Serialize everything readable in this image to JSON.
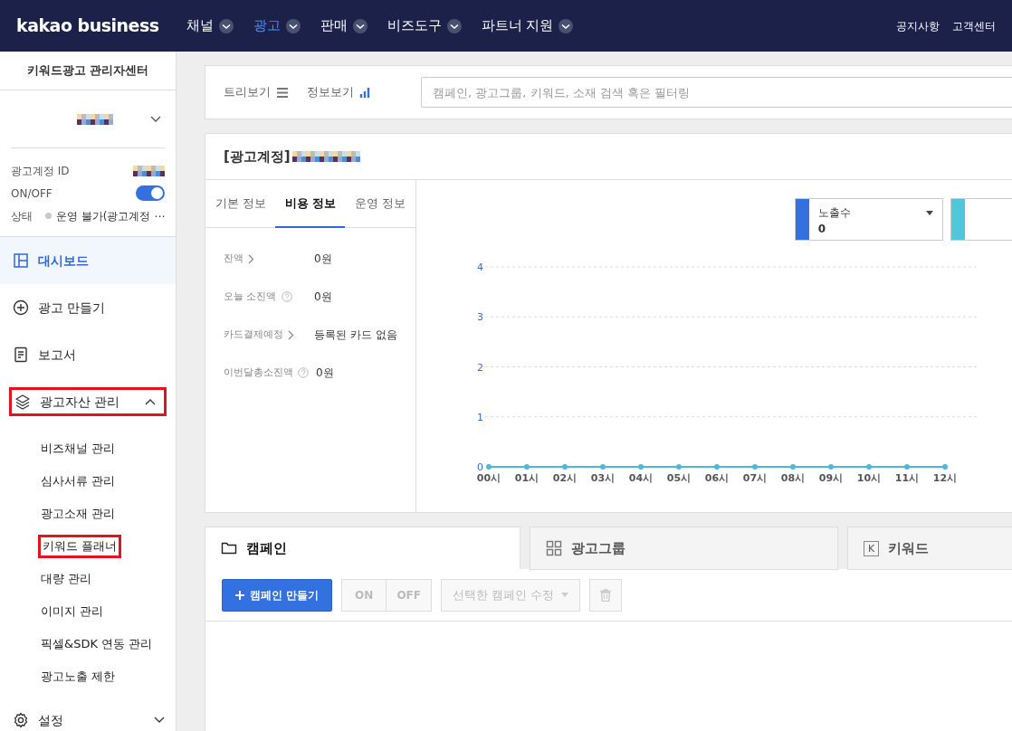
{
  "topnav": {
    "logo": "kakao business",
    "items": [
      {
        "label": "채널",
        "selected": false
      },
      {
        "label": "광고",
        "selected": true
      },
      {
        "label": "판매",
        "selected": false
      },
      {
        "label": "비즈도구",
        "selected": false
      },
      {
        "label": "파트너 지원",
        "selected": false
      }
    ],
    "links": [
      "공지사항",
      "고객센터"
    ]
  },
  "sidebar": {
    "title": "키워드광고 관리자센터",
    "info": [
      {
        "kind": "id",
        "label": "광고계정 ID"
      },
      {
        "kind": "toggle",
        "label": "ON/OFF",
        "on": true
      },
      {
        "kind": "status",
        "label": "상태",
        "value": "운영 불가(광고계정 ⋯"
      }
    ],
    "menu": [
      {
        "kind": "dashboard",
        "label": "대시보드",
        "selected": true,
        "highlighted": false
      },
      {
        "kind": "create",
        "label": "광고 만들기",
        "selected": false,
        "highlighted": false
      },
      {
        "kind": "report",
        "label": "보고서",
        "selected": false,
        "highlighted": false
      },
      {
        "kind": "assets",
        "label": "광고자산 관리",
        "selected": false,
        "highlighted": true,
        "expanded": true,
        "children": [
          {
            "label": "비즈채널 관리",
            "highlighted": false
          },
          {
            "label": "심사서류 관리",
            "highlighted": false
          },
          {
            "label": "광고소재 관리",
            "highlighted": false
          },
          {
            "label": "키워드 플래너",
            "highlighted": true
          },
          {
            "label": "대량 관리",
            "highlighted": false
          },
          {
            "label": "이미지 관리",
            "highlighted": false
          },
          {
            "label": "픽셀&SDK 연동 관리",
            "highlighted": false
          },
          {
            "label": "광고노출 제한",
            "highlighted": false
          }
        ]
      },
      {
        "kind": "settings",
        "label": "설정",
        "selected": false,
        "highlighted": false,
        "expanded": false
      }
    ]
  },
  "viewbar": {
    "views": [
      {
        "kind": "tree",
        "label": "트리보기"
      },
      {
        "kind": "info",
        "label": "정보보기"
      }
    ],
    "search": {
      "placeholder": "캠페인, 광고그룹, 키워드, 소재 검색 혹은 필터링"
    }
  },
  "account": {
    "title": "[광고계정]",
    "tabs": [
      {
        "label": "기본 정보",
        "selected": false
      },
      {
        "label": "비용 정보",
        "selected": true
      },
      {
        "label": "운영 정보",
        "selected": false
      }
    ],
    "rows": [
      {
        "label": "잔액",
        "kind": "link",
        "value": "0원"
      },
      {
        "label": "오늘 소진액",
        "kind": "help",
        "value": "0원"
      },
      {
        "label": "카드결제예정",
        "kind": "link",
        "value": "등록된 카드 없음"
      },
      {
        "label": "이번달총소진액",
        "kind": "help",
        "value": "0원"
      }
    ],
    "legend": [
      {
        "label": "노출수",
        "value": "0",
        "color": "#3370e0"
      },
      {
        "color": "#4fc6dc"
      }
    ],
    "chart_data": {
      "type": "line",
      "categories": [
        "00시",
        "01시",
        "02시",
        "03시",
        "04시",
        "05시",
        "06시",
        "07시",
        "08시",
        "09시",
        "10시",
        "11시",
        "12시"
      ],
      "series": [
        {
          "color": "#4fb6dc",
          "values": [
            0,
            0,
            0,
            0,
            0,
            0,
            0,
            0,
            0,
            0,
            0,
            0,
            0
          ]
        }
      ],
      "ylim": [
        0,
        4
      ],
      "yticks": [
        0,
        1,
        2,
        3,
        4
      ],
      "grid": true,
      "marker": true
    }
  },
  "bottom_tabs": [
    {
      "kind": "folder",
      "label": "캠페인",
      "selected": true
    },
    {
      "kind": "grid",
      "label": "광고그룹",
      "selected": false
    },
    {
      "kind": "letter",
      "icon_text": "K",
      "label": "키워드",
      "selected": false
    }
  ],
  "toolbar": {
    "create": "캠페인 만들기",
    "on": {
      "label": "ON",
      "disabled": true
    },
    "off": {
      "label": "OFF",
      "disabled": true
    },
    "edit": {
      "label": "선택한 캠페인 수정",
      "disabled": true
    },
    "delete": {
      "disabled": true
    }
  }
}
